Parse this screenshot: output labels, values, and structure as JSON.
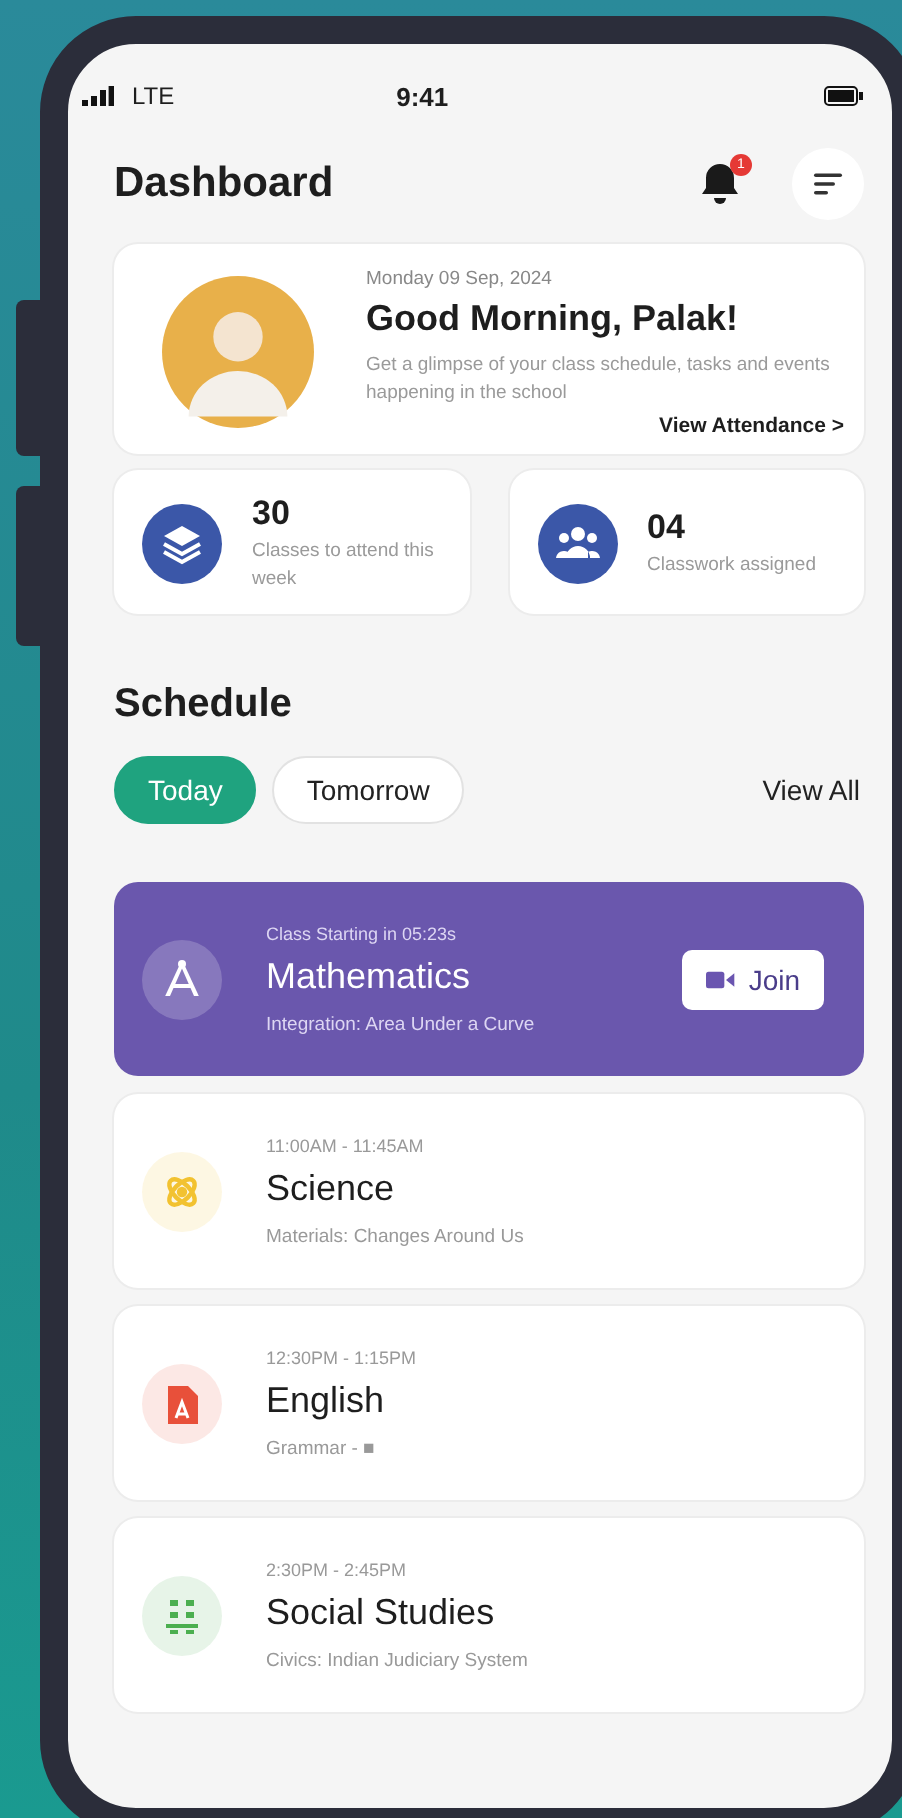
{
  "status_bar": {
    "carrier": "LTE",
    "time": "9:41"
  },
  "header": {
    "title": "Dashboard",
    "notification_count": "1"
  },
  "greeting": {
    "date": "Monday 09 Sep, 2024",
    "title": "Good Morning, Palak!",
    "description": "Get a glimpse of your class schedule, tasks and events happening in the school",
    "link": "View Attendance >"
  },
  "stats": [
    {
      "value": "30",
      "label": "Classes to attend this week"
    },
    {
      "value": "04",
      "label": "Classwork assigned"
    }
  ],
  "schedule": {
    "title": "Schedule",
    "tabs": [
      {
        "label": "Today",
        "selected": true
      },
      {
        "label": "Tomorrow",
        "selected": false
      }
    ],
    "view_all": "View All"
  },
  "classes": [
    {
      "kind": "live",
      "time": "Class Starting in 05:23s",
      "name": "Mathematics",
      "topic": "Integration: Area Under a Curve",
      "color": "#ffffff",
      "action": "Join"
    },
    {
      "kind": "upcoming",
      "time": "11:00AM - 11:45AM",
      "name": "Science",
      "topic": "Materials: Changes Around Us",
      "color": "#f2c230"
    },
    {
      "kind": "upcoming",
      "time": "12:30PM - 1:15PM",
      "name": "English",
      "topic": "Grammar - ■",
      "color": "#e8503a"
    },
    {
      "kind": "upcoming",
      "time": "2:30PM - 2:45PM",
      "name": "Social Studies",
      "topic": "Civics: Indian Judiciary System",
      "color": "#4caf50"
    }
  ]
}
